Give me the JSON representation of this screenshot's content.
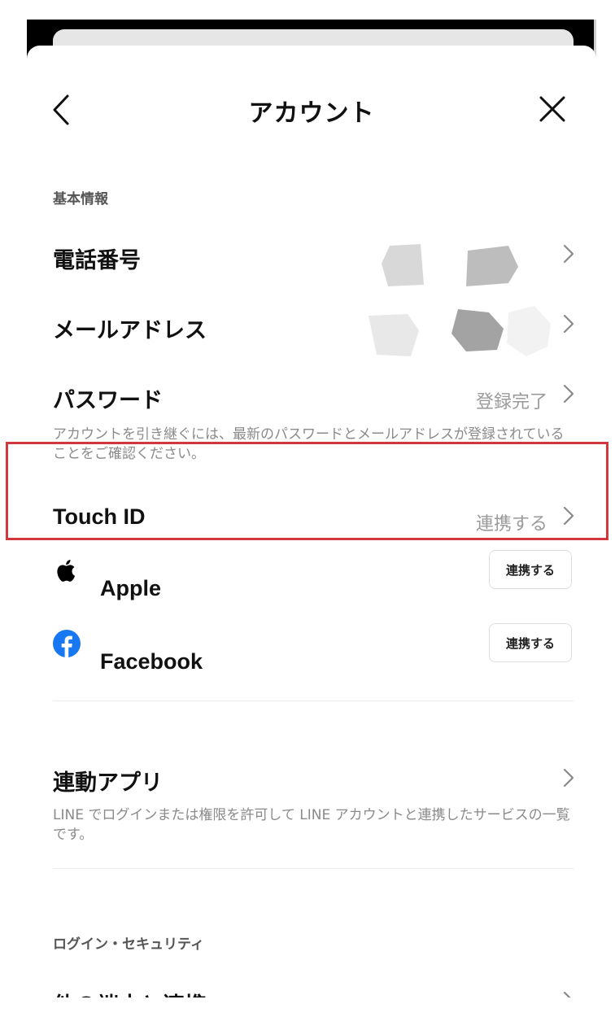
{
  "header": {
    "title": "アカウント"
  },
  "sections": {
    "basic_info_label": "基本情報",
    "login_security_label": "ログイン・セキュリティ"
  },
  "rows": {
    "phone": {
      "title": "電話番号"
    },
    "email": {
      "title": "メールアドレス"
    },
    "password": {
      "title": "パスワード",
      "value": "登録完了",
      "description": "アカウントを引き継ぐには、最新のパスワードとメールアドレスが登録されていることをご確認ください。"
    },
    "touch_id": {
      "title": "Touch ID",
      "value": "連携する"
    },
    "apple": {
      "title": "Apple",
      "button": "連携する",
      "icon": "apple-icon"
    },
    "facebook": {
      "title": "Facebook",
      "button": "連携する",
      "icon": "facebook-icon",
      "color": "#1877F2"
    },
    "linked_apps": {
      "title": "連動アプリ",
      "description": "LINE でログインまたは権限を許可して LINE アカウントと連携したサービスの一覧です。"
    },
    "other_devices": {
      "title": "他の端末と連携"
    }
  },
  "colors": {
    "highlight": "#d0383e",
    "facebook": "#1877F2"
  }
}
